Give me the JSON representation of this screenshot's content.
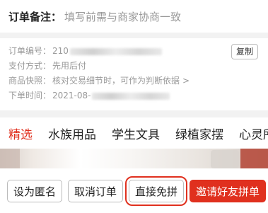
{
  "remark": {
    "label": "订单备注：",
    "placeholder": "填写前需与商家协商一致"
  },
  "order_info": {
    "order_no_label": "订单编号：",
    "order_no_value": "210",
    "copy_label": "复制",
    "pay_label": "支付方式：",
    "pay_value": "先用后付",
    "snapshot_label": "商品快照：",
    "snapshot_value": "核对交易细节时，可作为判断依据",
    "snapshot_chevron": ">",
    "time_label": "下单时间：",
    "time_value": "2021-08-"
  },
  "tabs": [
    "精选",
    "水族用品",
    "学生文具",
    "绿植家摆",
    "心灵所"
  ],
  "actions": {
    "anonymous": "设为匿名",
    "cancel": "取消订单",
    "free_group": "直接免拼",
    "invite": "邀请好友拼单"
  },
  "colors": {
    "accent": "#e0301e"
  }
}
